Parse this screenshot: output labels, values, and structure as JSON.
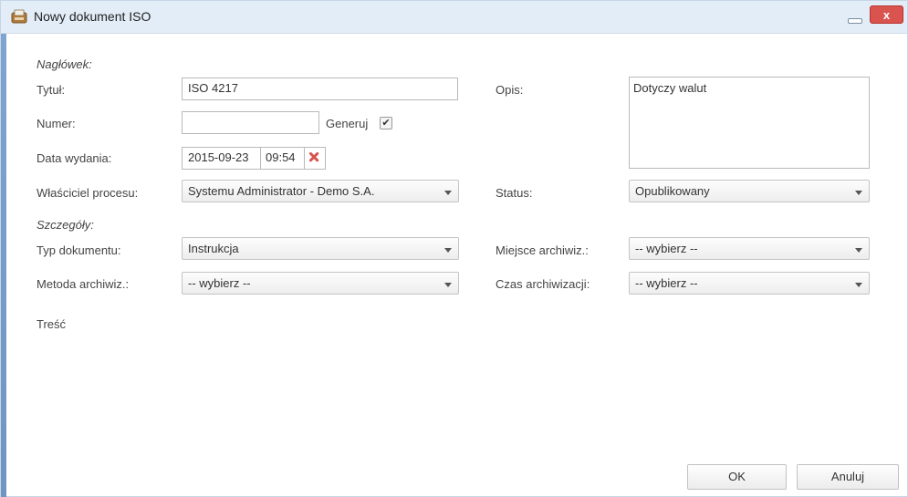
{
  "window": {
    "title": "Nowy dokument ISO",
    "close_label": "x"
  },
  "header_section": {
    "label": "Nagłówek:",
    "title_label": "Tytuł:",
    "title_value": "ISO 4217",
    "number_label": "Numer:",
    "number_value": "",
    "generate_label": "Generuj",
    "generate_checked": true,
    "date_label": "Data wydania:",
    "date_value": "2015-09-23",
    "time_value": "09:54",
    "owner_label": "Właściciel procesu:",
    "owner_value": "Systemu Administrator - Demo S.A.",
    "description_label": "Opis:",
    "description_value": "Dotyczy walut",
    "status_label": "Status:",
    "status_value": "Opublikowany"
  },
  "details_section": {
    "label": "Szczegóły:",
    "doc_type_label": "Typ dokumentu:",
    "doc_type_value": "Instrukcja",
    "archive_place_label": "Miejsce archiwiz.:",
    "archive_place_value": "-- wybierz --",
    "archive_method_label": "Metoda archiwiz.:",
    "archive_method_value": "-- wybierz --",
    "archive_time_label": "Czas archiwizacji:",
    "archive_time_value": "-- wybierz --"
  },
  "content_label": "Treść",
  "buttons": {
    "ok": "OK",
    "cancel": "Anuluj"
  },
  "colors": {
    "titlebar": "#e3edf7",
    "close": "#d9534f",
    "left_bar": "#7fa4cf",
    "delete_icon": "#d9534f"
  }
}
